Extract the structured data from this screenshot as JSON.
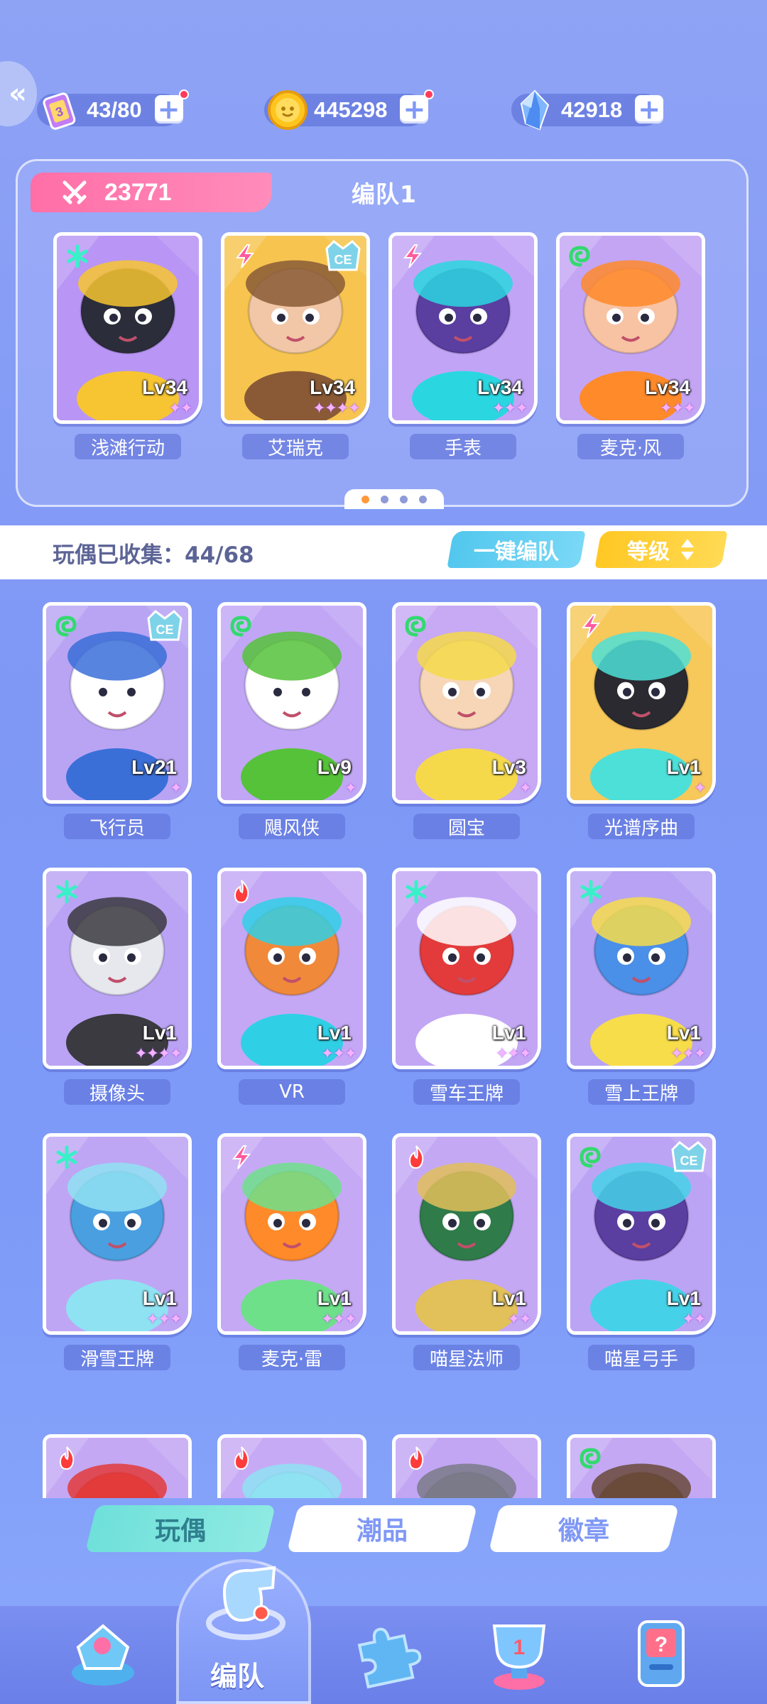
{
  "resources": {
    "stamina": {
      "value": "43/80",
      "icon": "stamina-ticket-icon"
    },
    "coins": {
      "value": "445298",
      "icon": "gold-coin-icon"
    },
    "gems": {
      "value": "42918",
      "icon": "crystal-icon"
    }
  },
  "team": {
    "power": "23771",
    "title": "编队1",
    "members": [
      {
        "name": "浅滩行动",
        "level": "Lv34",
        "stars": "✦✦",
        "element": "snow",
        "ce": false,
        "bg": "#b995f5",
        "skin": "#2b2d3a",
        "accent": "#f7c531"
      },
      {
        "name": "艾瑞克",
        "level": "Lv34",
        "stars": "✦✦✦✦",
        "element": "bolt",
        "ce": true,
        "bg": "#f7c54f",
        "skin": "#f1c7a7",
        "accent": "#8a5a36"
      },
      {
        "name": "手表",
        "level": "Lv34",
        "stars": "✦✦✦",
        "element": "bolt",
        "ce": false,
        "bg": "#c2a4f6",
        "skin": "#5a3ea0",
        "accent": "#2ad7e0"
      },
      {
        "name": "麦克·风",
        "level": "Lv34",
        "stars": "✦✦✦",
        "element": "wind",
        "ce": false,
        "bg": "#c4a5f4",
        "skin": "#f7c3a3",
        "accent": "#ff8a2a"
      }
    ],
    "pages": 4,
    "active_page": 0
  },
  "collection": {
    "text": "玩偶已收集：44/68",
    "auto_team_label": "一键编队",
    "sort_label": "等级"
  },
  "dolls": [
    {
      "name": "飞行员",
      "level": "Lv21",
      "stars": "✦",
      "element": "wind",
      "ce": true,
      "bg": "#b9a4f4",
      "skin": "#ffffff",
      "accent": "#3a6fd8"
    },
    {
      "name": "飓风侠",
      "level": "Lv9",
      "stars": "✦",
      "element": "wind",
      "ce": false,
      "bg": "#c1a6f6",
      "skin": "#ffffff",
      "accent": "#56c23a"
    },
    {
      "name": "圆宝",
      "level": "Lv3",
      "stars": "✦",
      "element": "wind",
      "ce": false,
      "bg": "#c7a9f4",
      "skin": "#f6d6b6",
      "accent": "#f5d94a"
    },
    {
      "name": "光谱序曲",
      "level": "Lv1",
      "stars": "✦",
      "element": "bolt",
      "ce": false,
      "bg": "#f7c85a",
      "skin": "#2a2a30",
      "accent": "#4de0d8"
    },
    {
      "name": "摄像头",
      "level": "Lv1",
      "stars": "✦✦✦✦",
      "element": "snow",
      "ce": false,
      "bg": "#baa3f4",
      "skin": "#e6e8ee",
      "accent": "#3a3a40"
    },
    {
      "name": "VR",
      "level": "Lv1",
      "stars": "✦✦✦",
      "element": "fire",
      "ce": false,
      "bg": "#c4a8f5",
      "skin": "#f08a3a",
      "accent": "#2fd0e6"
    },
    {
      "name": "雪车王牌",
      "level": "Lv1",
      "stars": "✦✦✦",
      "element": "snow",
      "ce": false,
      "bg": "#c2a6f4",
      "skin": "#e33b3b",
      "accent": "#ffffff"
    },
    {
      "name": "雪上王牌",
      "level": "Lv1",
      "stars": "✦✦✦",
      "element": "snow",
      "ce": false,
      "bg": "#b7a2f4",
      "skin": "#4a8fe8",
      "accent": "#f7dd4a"
    },
    {
      "name": "滑雪王牌",
      "level": "Lv1",
      "stars": "✦✦✦",
      "element": "snow",
      "ce": false,
      "bg": "#bfa6f4",
      "skin": "#4a9fe0",
      "accent": "#8fe2f2"
    },
    {
      "name": "麦克·雷",
      "level": "Lv1",
      "stars": "✦✦✦",
      "element": "bolt",
      "ce": false,
      "bg": "#c6a9f5",
      "skin": "#ff8a2a",
      "accent": "#6fe08a"
    },
    {
      "name": "喵星法师",
      "level": "Lv1",
      "stars": "✦✦",
      "element": "fire",
      "ce": false,
      "bg": "#c4a8f4",
      "skin": "#2f7b4a",
      "accent": "#e2c05a"
    },
    {
      "name": "喵星弓手",
      "level": "Lv1",
      "stars": "✦✦",
      "element": "wind",
      "ce": true,
      "bg": "#bca4f4",
      "skin": "#5a3ea0",
      "accent": "#45d2e8"
    }
  ],
  "partial_dolls": [
    {
      "element": "fire",
      "bg": "#c4a8f4",
      "accent": "#e33b3b"
    },
    {
      "element": "fire",
      "bg": "#c7aaf5",
      "accent": "#8fe2f2"
    },
    {
      "element": "fire",
      "bg": "#c2a6f4",
      "accent": "#7a7a88"
    },
    {
      "element": "wind",
      "bg": "#c4a8f4",
      "accent": "#6a4a3a"
    }
  ],
  "tabs": [
    {
      "label": "玩偶",
      "active": true
    },
    {
      "label": "潮品",
      "active": false
    },
    {
      "label": "徽章",
      "active": false
    }
  ],
  "nav": {
    "active_label": "编队",
    "items": [
      "shop-icon",
      "whistle-icon",
      "puzzle-icon",
      "trophy-icon",
      "mystery-machine-icon"
    ]
  }
}
